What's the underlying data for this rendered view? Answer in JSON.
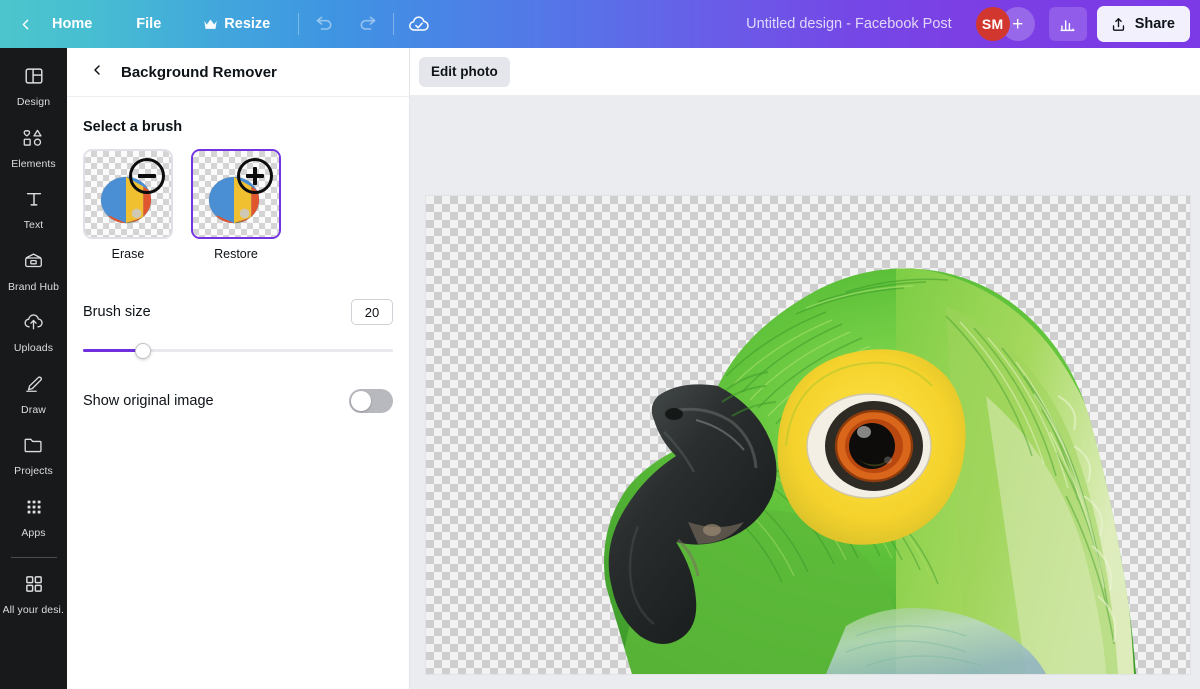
{
  "topbar": {
    "back_icon": "chevron-left-icon",
    "home_label": "Home",
    "file_label": "File",
    "resize_label": "Resize",
    "resize_icon": "crown-icon",
    "undo_icon": "undo-icon",
    "redo_icon": "redo-icon",
    "save_status_icon": "cloud-check-icon",
    "doc_title": "Untitled design - Facebook Post",
    "avatar_initials": "SM",
    "avatar_color": "#d1372f",
    "add_member_label": "+",
    "insights_icon": "bar-chart-icon",
    "share_icon": "share-upload-icon",
    "share_label": "Share",
    "gradient_start": "#4cc6cc",
    "gradient_mid": "#5a6fe8",
    "gradient_end": "#7c3ae6"
  },
  "rail": {
    "items": [
      {
        "id": "design",
        "label": "Design",
        "icon": "layout-grid-icon"
      },
      {
        "id": "elements",
        "label": "Elements",
        "icon": "shapes-icon"
      },
      {
        "id": "text",
        "label": "Text",
        "icon": "text-t-icon"
      },
      {
        "id": "brand-hub",
        "label": "Brand Hub",
        "icon": "brand-palette-icon"
      },
      {
        "id": "uploads",
        "label": "Uploads",
        "icon": "cloud-upload-icon"
      },
      {
        "id": "draw",
        "label": "Draw",
        "icon": "pen-icon"
      },
      {
        "id": "projects",
        "label": "Projects",
        "icon": "folder-icon"
      },
      {
        "id": "apps",
        "label": "Apps",
        "icon": "apps-dots-icon"
      }
    ],
    "footer": {
      "id": "all-your-designs",
      "label": "All your desi...",
      "icon": "squares-icon"
    }
  },
  "panel": {
    "back_icon": "chevron-left-icon",
    "title": "Background Remover",
    "section_title": "Select a brush",
    "brushes": [
      {
        "id": "erase",
        "label": "Erase",
        "badge": "minus-circle-icon",
        "selected": false
      },
      {
        "id": "restore",
        "label": "Restore",
        "badge": "plus-circle-icon",
        "selected": true
      }
    ],
    "brush_size_label": "Brush size",
    "brush_size_value": "20",
    "brush_size_percent": 20,
    "accent_color": "#6f2fdf",
    "show_original_label": "Show original image",
    "show_original_on": false
  },
  "canvas": {
    "edit_photo_label": "Edit photo",
    "background": "transparent-checkerboard",
    "image_subject": "green-parrot-head"
  }
}
